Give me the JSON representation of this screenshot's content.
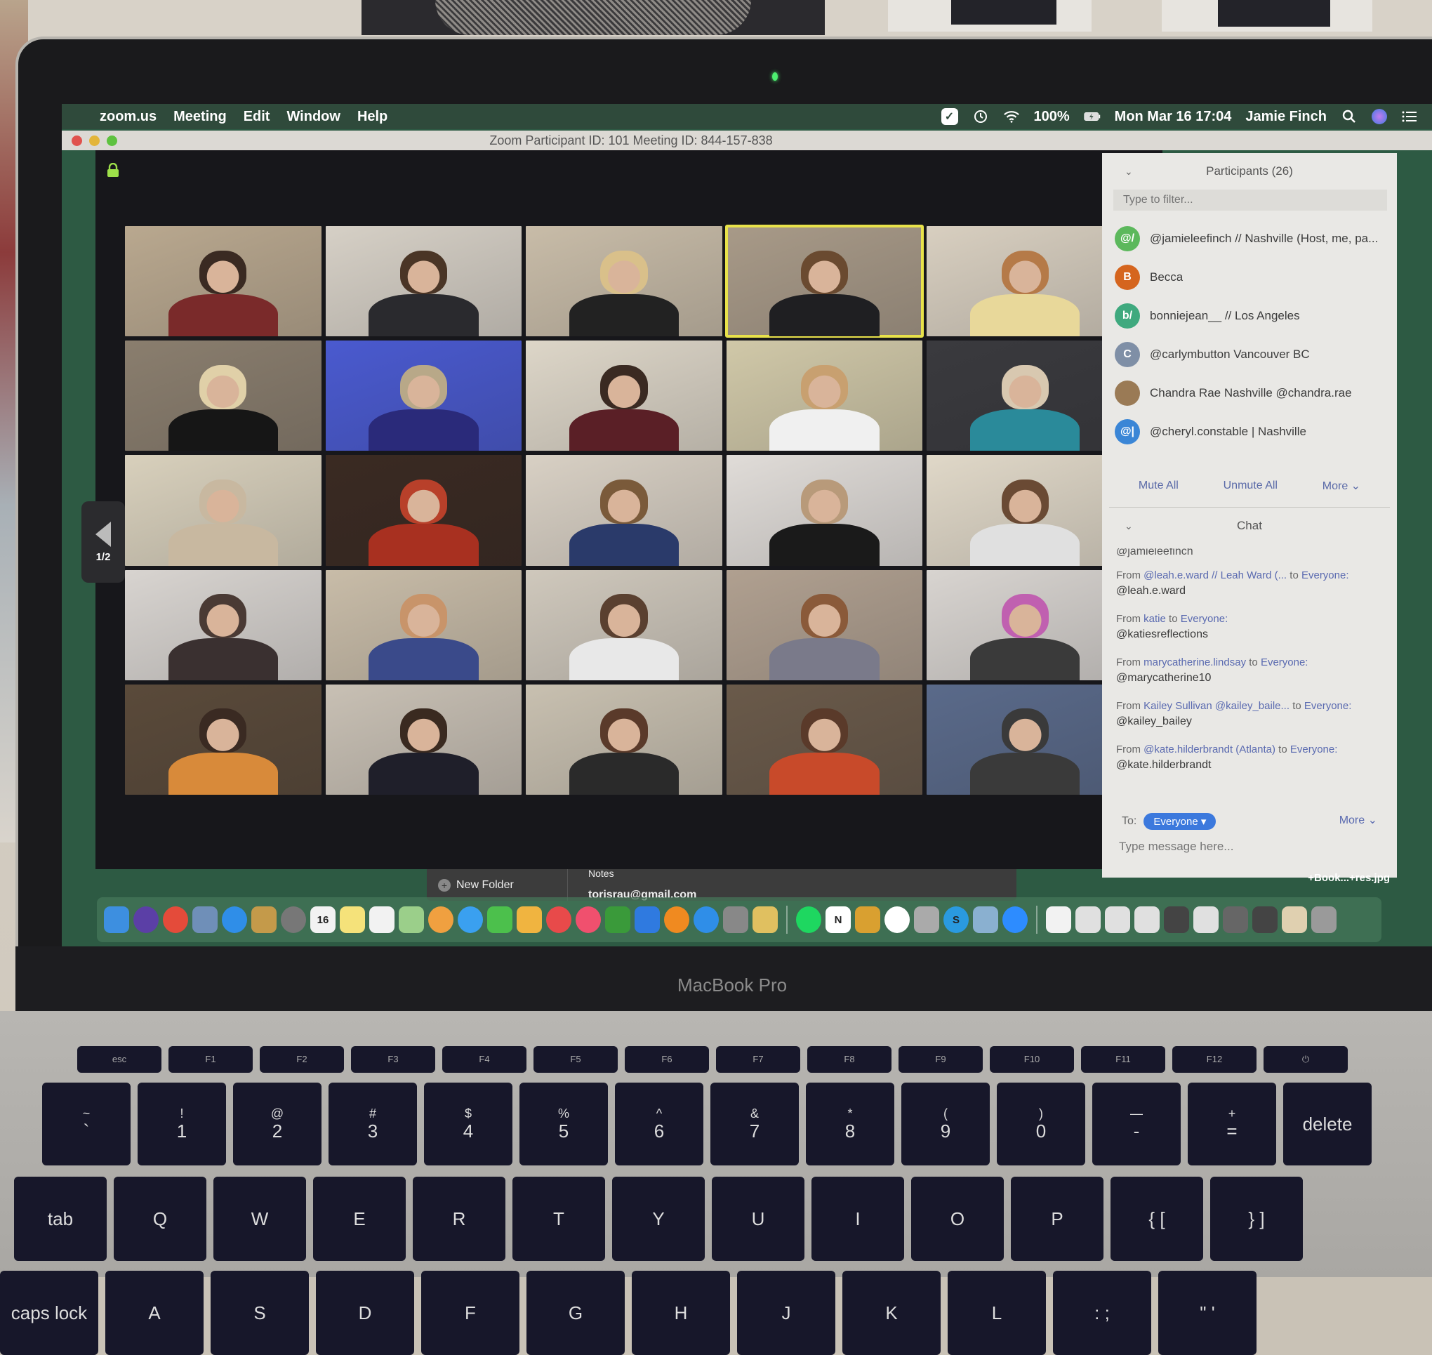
{
  "menubar": {
    "app_name": "zoom.us",
    "menus": [
      "Meeting",
      "Edit",
      "Window",
      "Help"
    ],
    "battery": "100%",
    "datetime": "Mon Mar 16  17:04",
    "user": "Jamie Finch"
  },
  "window": {
    "title": "Zoom Participant ID: 101   Meeting ID: 844-157-838"
  },
  "video": {
    "page_indicator_prev": "1/2",
    "page_indicator_next": "1/2",
    "tiles": 25,
    "active_speaker_index": 3
  },
  "participants": {
    "header": "Participants (26)",
    "filter_placeholder": "Type to filter...",
    "items": [
      {
        "initials": "@/",
        "name": "@jamieleefinch // Nashville (Host, me, pa...",
        "color": "#5cb85c"
      },
      {
        "initials": "B",
        "name": "Becca",
        "color": "#d5651e"
      },
      {
        "initials": "b/",
        "name": "bonniejean__ // Los Angeles",
        "color": "#3fa97e"
      },
      {
        "initials": "C",
        "name": "@carlymbutton Vancouver BC",
        "color": "#7f8fa6"
      },
      {
        "initials": "",
        "name": "Chandra Rae Nashville @chandra.rae",
        "color": "#9a7a55"
      },
      {
        "initials": "@|",
        "name": "@cheryl.constable | Nashville",
        "color": "#3b86d6"
      }
    ],
    "mute_all": "Mute All",
    "unmute_all": "Unmute All",
    "more": "More ⌄"
  },
  "chat": {
    "header": "Chat",
    "cut_text": "@jamieleefinch",
    "messages": [
      {
        "from_label": "From",
        "from": "@leah.e.ward // Leah Ward (...",
        "to_label": "to",
        "to": "Everyone:",
        "text": "@leah.e.ward"
      },
      {
        "from_label": "From",
        "from": "katie",
        "to_label": "to",
        "to": "Everyone:",
        "text": "@katiesreflections"
      },
      {
        "from_label": "From",
        "from": "marycatherine.lindsay",
        "to_label": "to",
        "to": "Everyone:",
        "text": "@marycatherine10"
      },
      {
        "from_label": "From",
        "from": "Kailey Sullivan @kailey_baile...",
        "to_label": "to",
        "to": "Everyone:",
        "text": "@kailey_bailey"
      },
      {
        "from_label": "From",
        "from": "@kate.hilderbrandt (Atlanta)",
        "to_label": "to",
        "to": "Everyone:",
        "text": "@kate.hilderbrandt"
      }
    ],
    "to_label": "To:",
    "recipient": "Everyone ▾",
    "more": "More ⌄",
    "input_placeholder": "Type message here..."
  },
  "finder": {
    "new_folder": "New Folder",
    "notes": "Notes",
    "email": "torisrau@gmail.com",
    "file_label": "+Book...+res.jpg"
  },
  "dock": {
    "apps": [
      {
        "name": "finder",
        "color": "#3d8fe0"
      },
      {
        "name": "siri",
        "color": "#5b3fa6",
        "round": true
      },
      {
        "name": "chrome",
        "color": "#e44b3a",
        "round": true
      },
      {
        "name": "preview",
        "color": "#6f8fb8"
      },
      {
        "name": "safari",
        "color": "#2f8ee8",
        "round": true
      },
      {
        "name": "contacts",
        "color": "#c49a4a"
      },
      {
        "name": "launchpad",
        "color": "#777",
        "round": true
      },
      {
        "name": "calendar",
        "color": "#f2f2f2",
        "label": "16"
      },
      {
        "name": "notes",
        "color": "#f5e27a"
      },
      {
        "name": "reminders",
        "color": "#f2f2f2"
      },
      {
        "name": "maps",
        "color": "#9bcf8a"
      },
      {
        "name": "photos",
        "color": "#f0a040",
        "round": true
      },
      {
        "name": "messages",
        "color": "#3aa0f0",
        "round": true
      },
      {
        "name": "facetime",
        "color": "#4cc04c"
      },
      {
        "name": "pages",
        "color": "#f0b440"
      },
      {
        "name": "news",
        "color": "#e84a4a",
        "round": true
      },
      {
        "name": "music",
        "color": "#f0506e",
        "round": true
      },
      {
        "name": "numbers",
        "color": "#3a9a3a"
      },
      {
        "name": "keynote",
        "color": "#2f7ae0"
      },
      {
        "name": "books",
        "color": "#f08a20",
        "round": true
      },
      {
        "name": "app-store",
        "color": "#2f8ee8",
        "round": true
      },
      {
        "name": "system-preferences",
        "color": "#888"
      },
      {
        "name": "automator",
        "color": "#e0c060"
      },
      {
        "sep": true
      },
      {
        "name": "spotify",
        "color": "#1ed760",
        "round": true
      },
      {
        "name": "notion",
        "color": "#fff",
        "label": "N"
      },
      {
        "name": "keychain",
        "color": "#d9a030"
      },
      {
        "name": "slack",
        "color": "#fff",
        "round": true
      },
      {
        "name": "utilities",
        "color": "#aaa"
      },
      {
        "name": "skype",
        "color": "#2a9ae0",
        "round": true,
        "label": "S"
      },
      {
        "name": "image-capture",
        "color": "#8ab0d0"
      },
      {
        "name": "zoom",
        "color": "#2d8cff",
        "round": true
      },
      {
        "sep": true
      },
      {
        "name": "doc-lock",
        "color": "#f2f2f2"
      },
      {
        "name": "doc-1",
        "color": "#e0e0e0"
      },
      {
        "name": "doc-2",
        "color": "#e0e0e0"
      },
      {
        "name": "doc-3",
        "color": "#e0e0e0"
      },
      {
        "name": "doc-4",
        "color": "#444"
      },
      {
        "name": "doc-5",
        "color": "#e0e0e0"
      },
      {
        "name": "doc-6",
        "color": "#666"
      },
      {
        "name": "doc-7",
        "color": "#444"
      },
      {
        "name": "doc-8",
        "color": "#e0d0b0"
      },
      {
        "name": "trash",
        "color": "#9a9a9a"
      }
    ]
  },
  "laptop": {
    "brand": "MacBook Pro",
    "keys": {
      "fn_row": [
        "esc",
        "F1",
        "F2",
        "F3",
        "F4",
        "F5",
        "F6",
        "F7",
        "F8",
        "F9",
        "F10",
        "F11",
        "F12",
        "⏻"
      ],
      "num_row": [
        [
          "~",
          "`"
        ],
        [
          "!",
          "1"
        ],
        [
          "@",
          "2"
        ],
        [
          "#",
          "3"
        ],
        [
          "$",
          "4"
        ],
        [
          "%",
          "5"
        ],
        [
          "^",
          "6"
        ],
        [
          "&",
          "7"
        ],
        [
          "*",
          "8"
        ],
        [
          "(",
          "9"
        ],
        [
          ")",
          "0"
        ],
        [
          "—",
          "-"
        ],
        [
          "+",
          "="
        ],
        [
          "",
          "delete"
        ]
      ],
      "q_row": [
        "tab",
        "Q",
        "W",
        "E",
        "R",
        "T",
        "Y",
        "U",
        "I",
        "O",
        "P",
        "{ [",
        "} ]"
      ],
      "a_row": [
        "caps lock",
        "A",
        "S",
        "D",
        "F",
        "G",
        "H",
        "J",
        "K",
        "L",
        ": ;",
        "\" '"
      ]
    }
  }
}
